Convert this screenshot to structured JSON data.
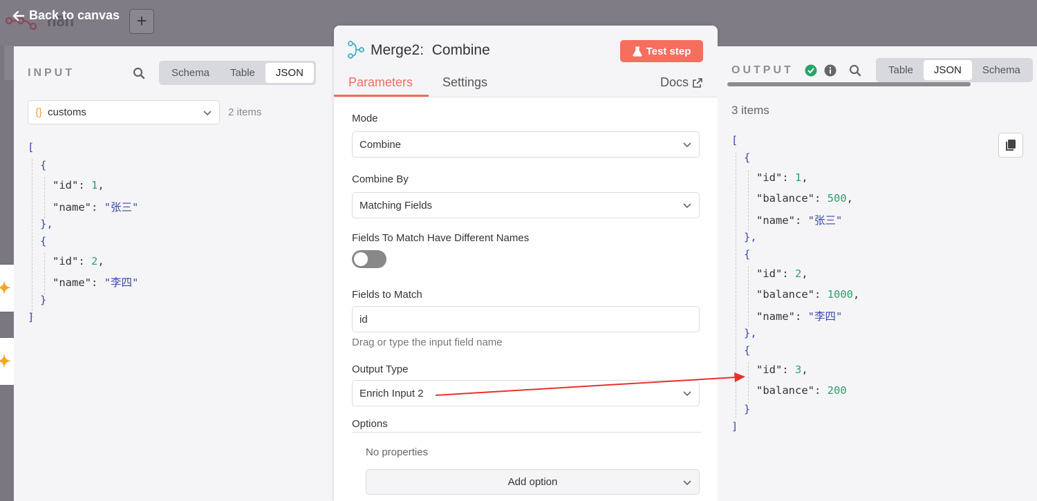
{
  "topbar": {
    "back_label": "Back to canvas",
    "logo_text": "n8n",
    "plus_label": "+"
  },
  "input": {
    "title": "INPUT",
    "tabs": [
      "Schema",
      "Table",
      "JSON"
    ],
    "active_tab": "JSON",
    "source": "customs",
    "count": "2 items",
    "json": [
      {
        "id": "1",
        "name": "\"张三\""
      },
      {
        "id": "2",
        "name": "\"李四\""
      }
    ]
  },
  "ndv": {
    "node_name": "Merge2",
    "node_op": "Combine",
    "test_label": "Test step",
    "tab_parameters": "Parameters",
    "tab_settings": "Settings",
    "docs_label": "Docs",
    "mode_label": "Mode",
    "mode_value": "Combine",
    "combine_by_label": "Combine By",
    "combine_by_value": "Matching Fields",
    "diff_names_label": "Fields To Match Have Different Names",
    "diff_names_on": false,
    "fields_label": "Fields to Match",
    "fields_value": "id",
    "fields_hint": "Drag or type the input field name",
    "output_type_label": "Output Type",
    "output_type_value": "Enrich Input 2",
    "options_label": "Options",
    "no_properties": "No properties",
    "add_option": "Add option"
  },
  "output": {
    "title": "OUTPUT",
    "tabs": [
      "Table",
      "JSON",
      "Schema"
    ],
    "active_tab": "JSON",
    "count": "3 items",
    "json": [
      {
        "id": "1",
        "balance": "500",
        "name": "\"张三\""
      },
      {
        "id": "2",
        "balance": "1000",
        "name": "\"李四\""
      },
      {
        "id": "3",
        "balance": "200"
      }
    ]
  },
  "colors": {
    "accent": "#ee6e5d",
    "success": "#28a36a",
    "string": "#3b4aa8",
    "annotation": "#e8322a"
  }
}
